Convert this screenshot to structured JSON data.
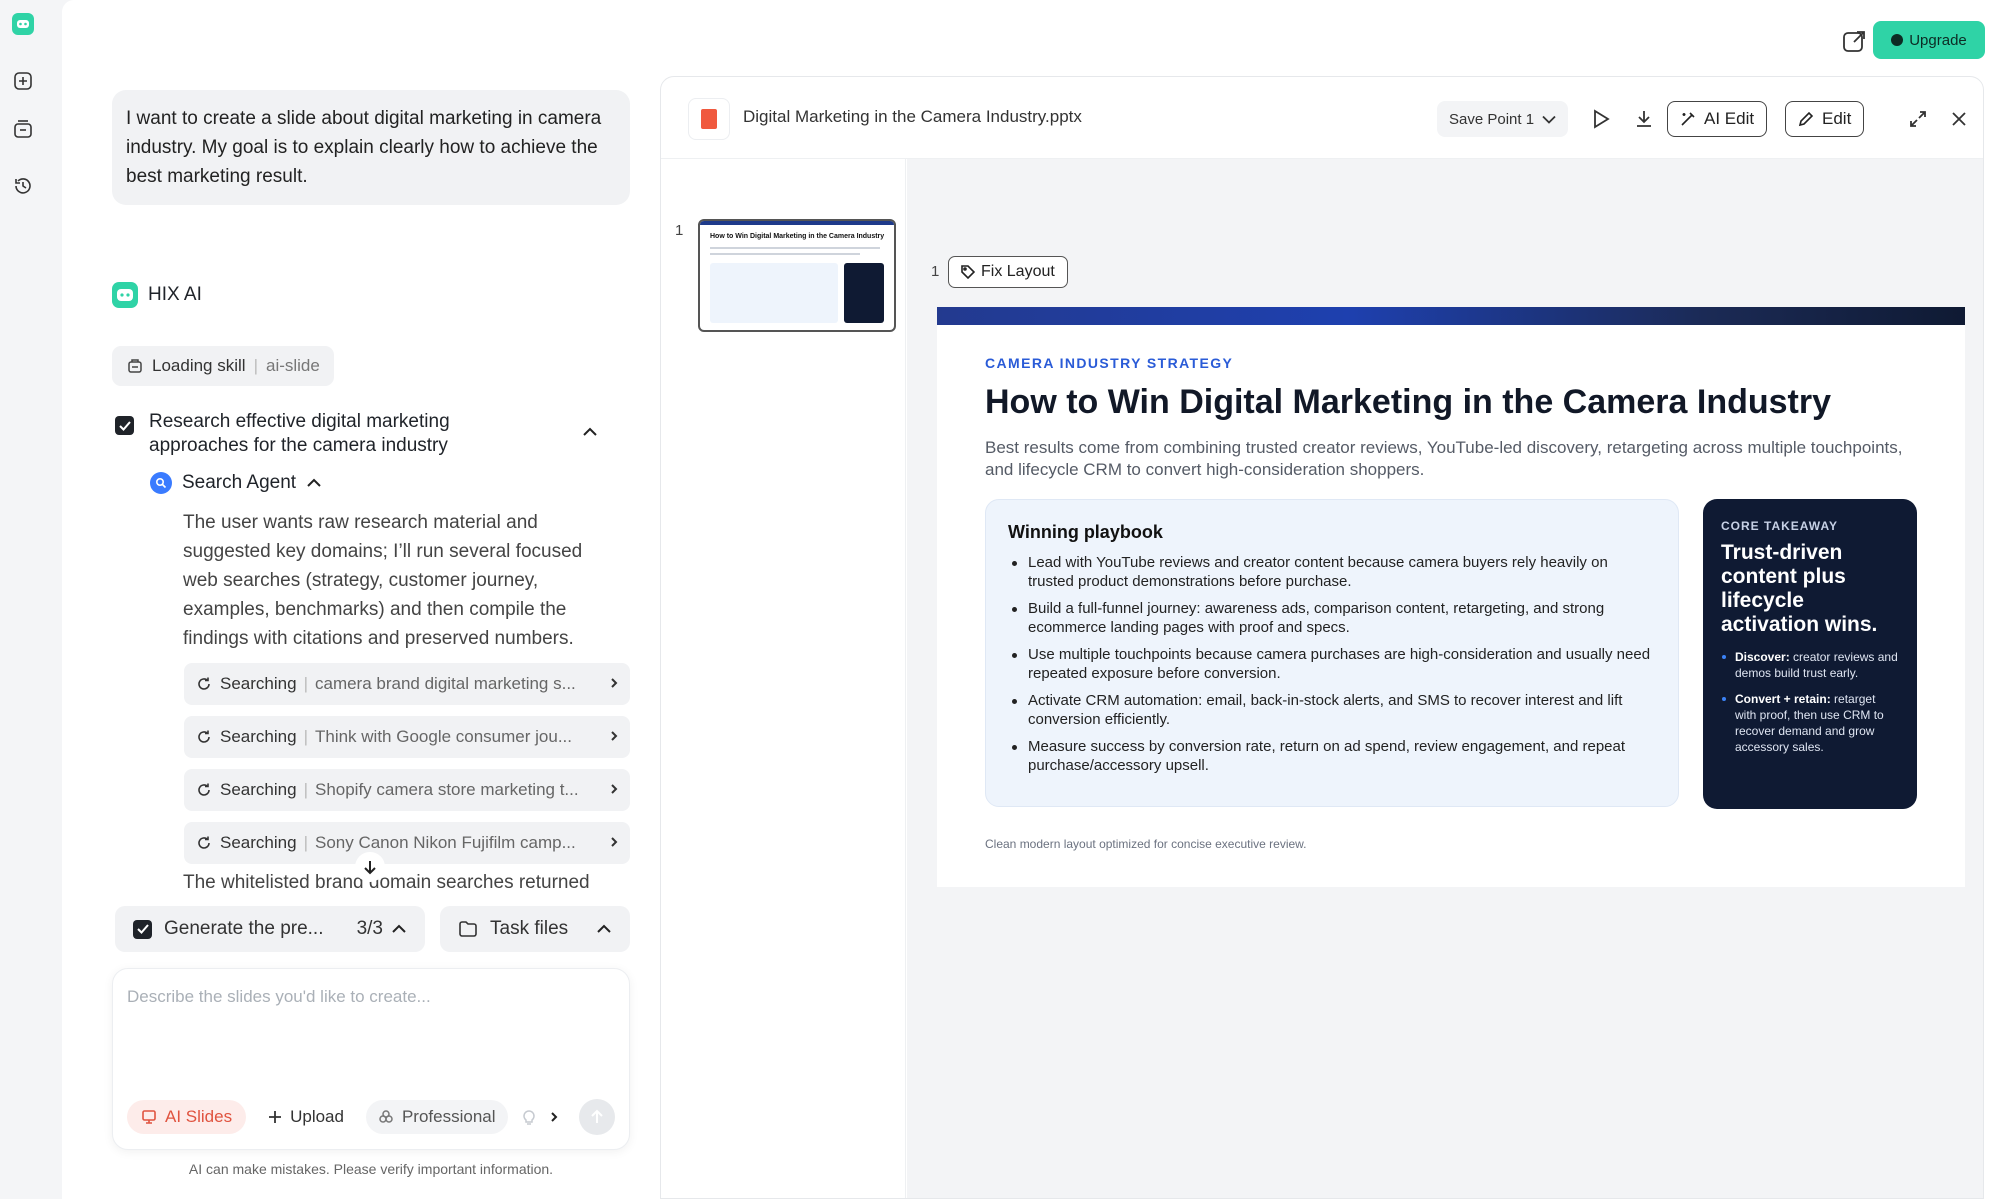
{
  "rail": {
    "icons": [
      "hix-logo-icon",
      "new-chat-icon",
      "library-icon",
      "history-icon"
    ]
  },
  "topbar": {
    "upgrade_label": "Upgrade"
  },
  "chat": {
    "user_message": "I want to create a slide about digital marketing in camera industry. My goal is to explain clearly how to achieve the best marketing result.",
    "assistant_name": "HIX AI",
    "skill_chip": {
      "label": "Loading skill",
      "value": "ai-slide"
    },
    "task": {
      "title": "Research effective digital marketing approaches for the camera industry",
      "agent": "Search Agent",
      "thought": "The user wants raw research material and suggested key domains; I’ll run several focused web searches (strategy, customer journey, examples, benchmarks) and then compile the findings with citations and preserved numbers.",
      "searches": [
        {
          "label": "Searching",
          "query": "camera brand digital marketing s..."
        },
        {
          "label": "Searching",
          "query": "Think with Google consumer jou..."
        },
        {
          "label": "Searching",
          "query": "Shopify camera store marketing t..."
        },
        {
          "label": "Searching",
          "query": "Sony Canon Nikon Fujifilm camp..."
        }
      ],
      "trailing_text": "The whitelisted brand domain searches returned"
    },
    "progress_bar": {
      "label": "Generate the pre...",
      "count": "3/3"
    },
    "files_bar": {
      "label": "Task files"
    },
    "composer": {
      "placeholder": "Describe the slides you'd like to create...",
      "ai_slides": "AI Slides",
      "upload": "Upload",
      "professional": "Professional"
    },
    "disclaimer": "AI can make mistakes. Please verify important information."
  },
  "preview": {
    "file_name": "Digital Marketing in the Camera Industry.pptx",
    "save_point": "Save Point 1",
    "ai_edit": "AI Edit",
    "edit": "Edit",
    "thumb_number": "1",
    "slide_number": "1",
    "fix_layout": "Fix Layout",
    "slide": {
      "eyebrow": "CAMERA INDUSTRY STRATEGY",
      "title": "How to Win Digital Marketing in the Camera Industry",
      "lede": "Best results come from combining trusted creator reviews, YouTube-led discovery, retargeting across multiple touchpoints, and lifecycle CRM to convert high-consideration shoppers.",
      "playbook_title": "Winning playbook",
      "playbook_items": [
        "Lead with YouTube reviews and creator content because camera buyers rely heavily on trusted product demonstrations before purchase.",
        "Build a full-funnel journey: awareness ads, comparison content, retargeting, and strong ecommerce landing pages with proof and specs.",
        "Use multiple touchpoints because camera purchases are high-consideration and usually need repeated exposure before conversion.",
        "Activate CRM automation: email, back-in-stock alerts, and SMS to recover interest and lift conversion efficiently.",
        "Measure success by conversion rate, return on ad spend, review engagement, and repeat purchase/accessory upsell."
      ],
      "takeaway_kicker": "CORE TAKEAWAY",
      "takeaway_title": "Trust-driven content plus lifecycle activation wins.",
      "takeaway_items": [
        {
          "lead": "Discover:",
          "text": "creator reviews and demos build trust early."
        },
        {
          "lead": "Convert + retain:",
          "text": "retarget with proof, then use CRM to recover demand and grow accessory sales."
        }
      ],
      "footnote": "Clean modern layout optimized for concise executive review."
    },
    "thumb_title": "How to Win Digital Marketing in the Camera Industry"
  },
  "colors": {
    "accent": "#2fd3a6",
    "ai_slides": "#e0533f",
    "slide_dark": "#0f1a33",
    "eyebrow": "#2a5bd7"
  }
}
